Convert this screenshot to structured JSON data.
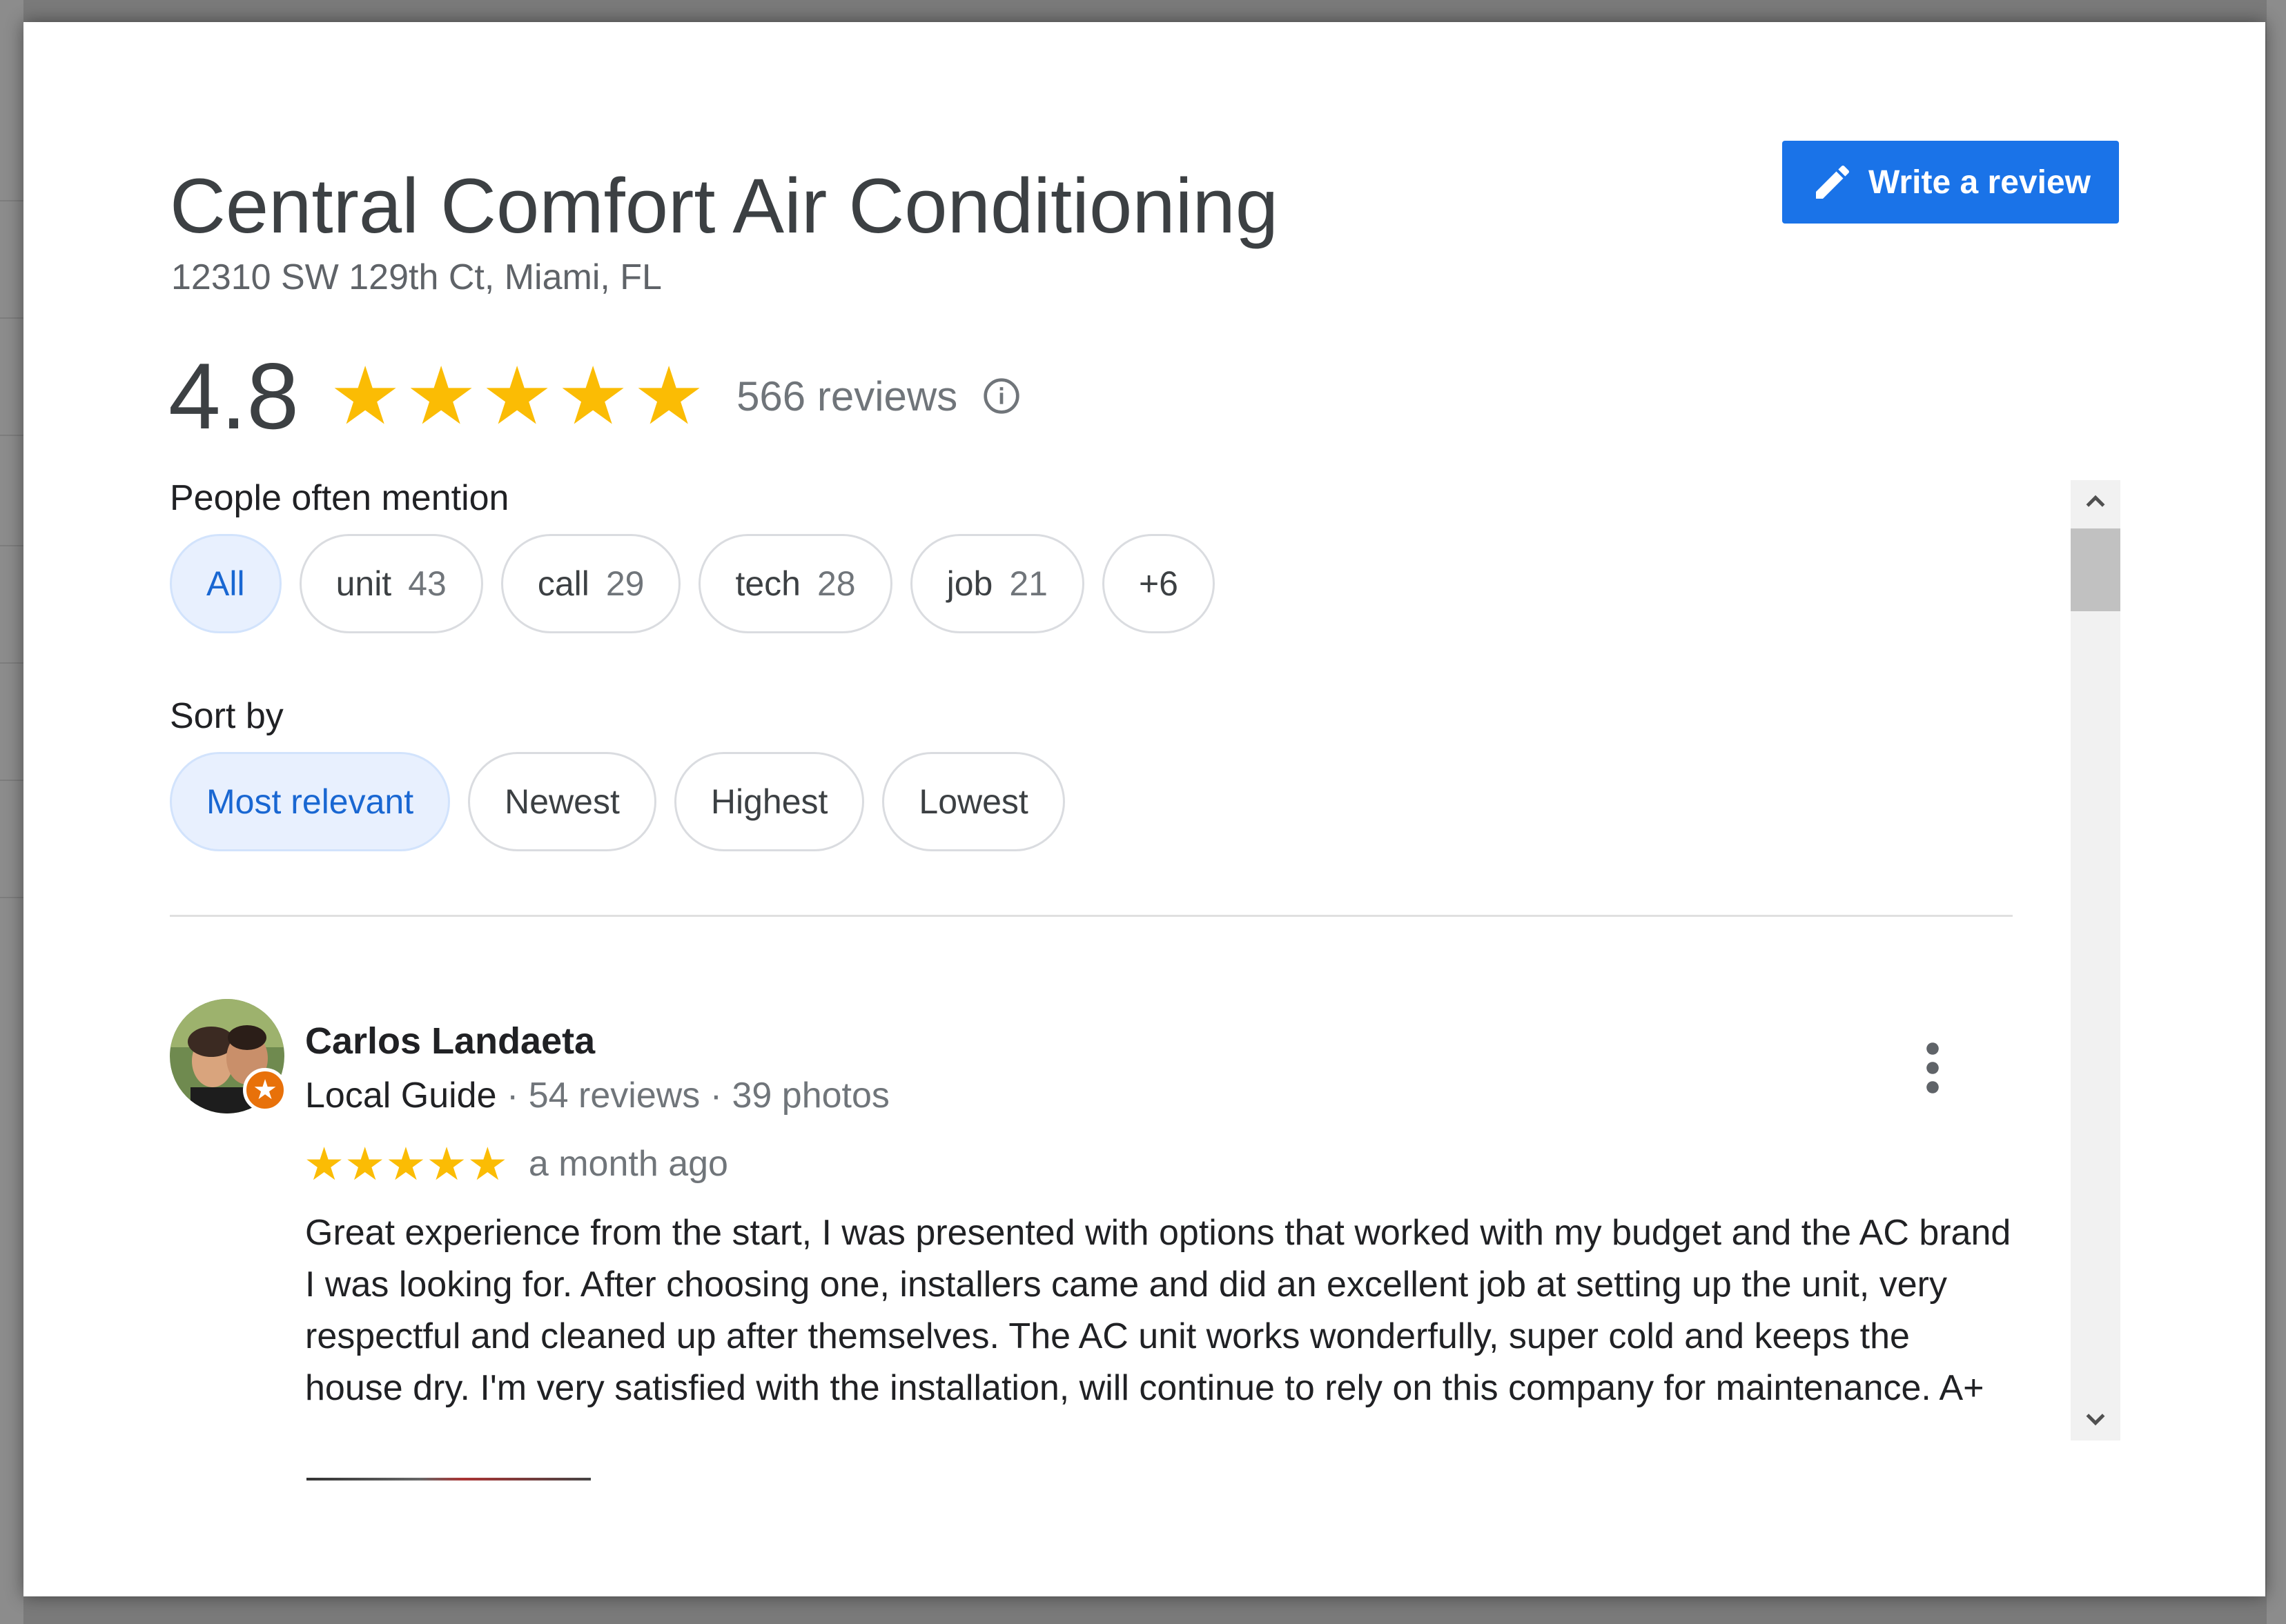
{
  "dialog": {
    "title": "Central Comfort Air Conditioning",
    "address": "12310 SW 129th Ct, Miami, FL",
    "write_review_label": "Write a review"
  },
  "rating": {
    "value": "4.8",
    "stars": 5,
    "review_count": "566 reviews"
  },
  "mentions": {
    "label": "People often mention",
    "chips": [
      {
        "label": "All",
        "count": ""
      },
      {
        "label": "unit",
        "count": "43"
      },
      {
        "label": "call",
        "count": "29"
      },
      {
        "label": "tech",
        "count": "28"
      },
      {
        "label": "job",
        "count": "21"
      },
      {
        "label": "+6",
        "count": ""
      }
    ]
  },
  "sort": {
    "label": "Sort by",
    "options": [
      "Most relevant",
      "Newest",
      "Highest",
      "Lowest"
    ],
    "selected": "Most relevant"
  },
  "review": {
    "author": "Carlos Landaeta",
    "badge": "Local Guide",
    "reviews": "· 54 reviews",
    "photos": "· 39 photos",
    "stars": 5,
    "time": "a month ago",
    "text": "Great experience from the start, I was presented with options that worked with my budget and the AC brand I was looking for. After choosing one, installers came and did an excellent job at setting up the unit, very respectful and cleaned up after themselves. The AC unit works wonderfully, super cold and keeps the house dry. I'm very satisfied with the installation, will continue to rely on this company for maintenance. A+"
  },
  "colors": {
    "accent_blue": "#1a73e8",
    "star_yellow": "#fbbc04",
    "chip_selected_bg": "#e8f0fe",
    "local_guide_orange": "#e8710a"
  },
  "icons": [
    "pencil-icon",
    "star-icon",
    "info-icon",
    "more-vert-icon",
    "chevron-up-icon",
    "chevron-down-icon"
  ]
}
